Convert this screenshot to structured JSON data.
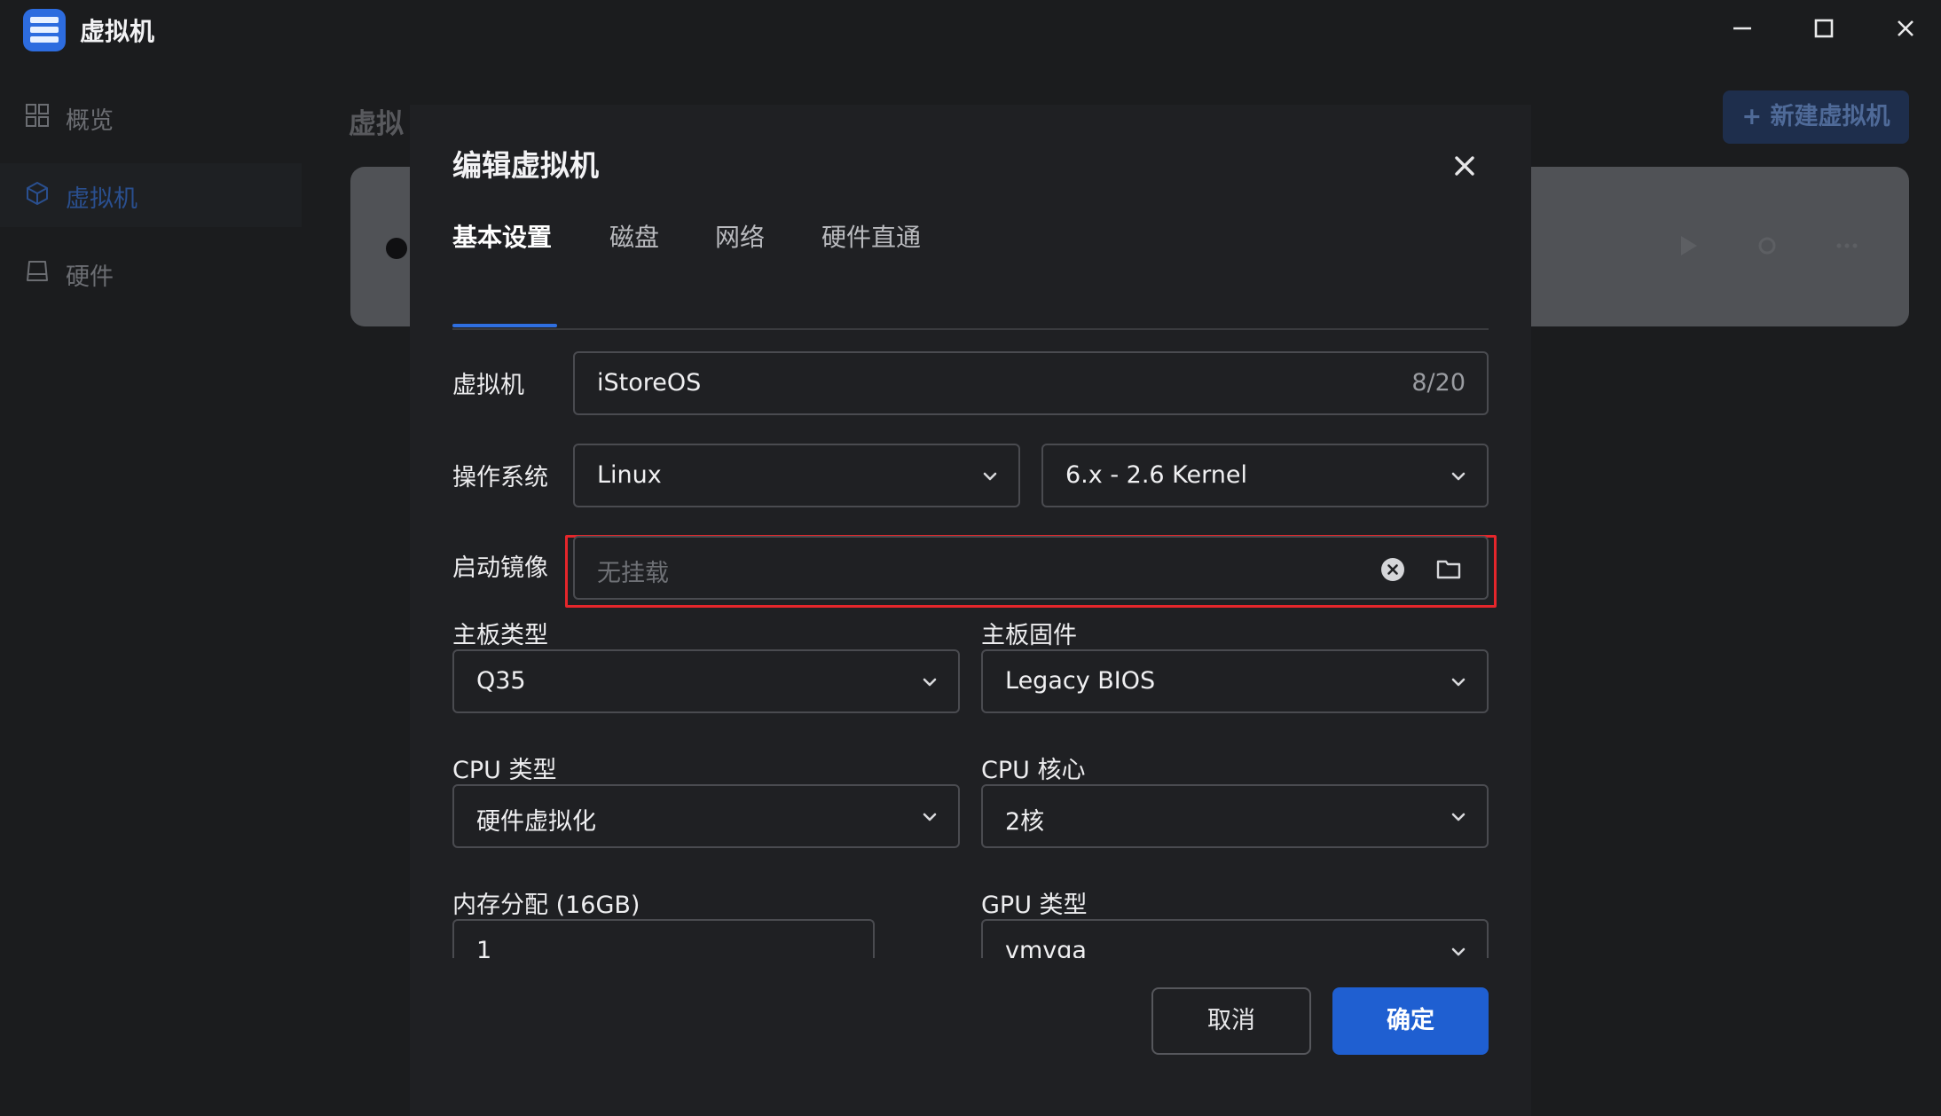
{
  "app": {
    "title": "虚拟机",
    "accent_color": "#2f6fe0",
    "window_buttons": [
      "minimize-icon",
      "maximize-icon",
      "close-icon"
    ]
  },
  "sidebar": {
    "items": [
      {
        "label": "概览",
        "icon": "grid-icon",
        "active": false
      },
      {
        "label": "虚拟机",
        "icon": "cube-icon",
        "active": true
      },
      {
        "label": "硬件",
        "icon": "drive-icon",
        "active": false
      }
    ]
  },
  "main": {
    "title_partial": "虚拟",
    "new_vm_button": "+ 新建虚拟机"
  },
  "modal": {
    "title": "编辑虚拟机",
    "tabs": [
      {
        "label": "基本设置",
        "active": true
      },
      {
        "label": "磁盘",
        "active": false
      },
      {
        "label": "网络",
        "active": false
      },
      {
        "label": "硬件直通",
        "active": false
      }
    ],
    "fields": {
      "vm_name": {
        "label": "虚拟机",
        "value": "iStoreOS",
        "counter": "8/20"
      },
      "os": {
        "label": "操作系统",
        "type_value": "Linux",
        "version_value": "6.x - 2.6 Kernel"
      },
      "boot_image": {
        "label": "启动镜像",
        "placeholder": "无挂载",
        "highlighted": true
      },
      "board_type": {
        "label": "主板类型",
        "value": "Q35"
      },
      "board_firmware": {
        "label": "主板固件",
        "value": "Legacy BIOS"
      },
      "cpu_type": {
        "label": "CPU 类型",
        "value": "硬件虚拟化"
      },
      "cpu_cores": {
        "label": "CPU 核心",
        "value": "2核"
      },
      "memory": {
        "label": "内存分配 (16GB)",
        "value": "1"
      },
      "gpu_type": {
        "label": "GPU 类型",
        "value": "vmvga"
      }
    },
    "buttons": {
      "cancel": "取消",
      "confirm": "确定"
    }
  }
}
